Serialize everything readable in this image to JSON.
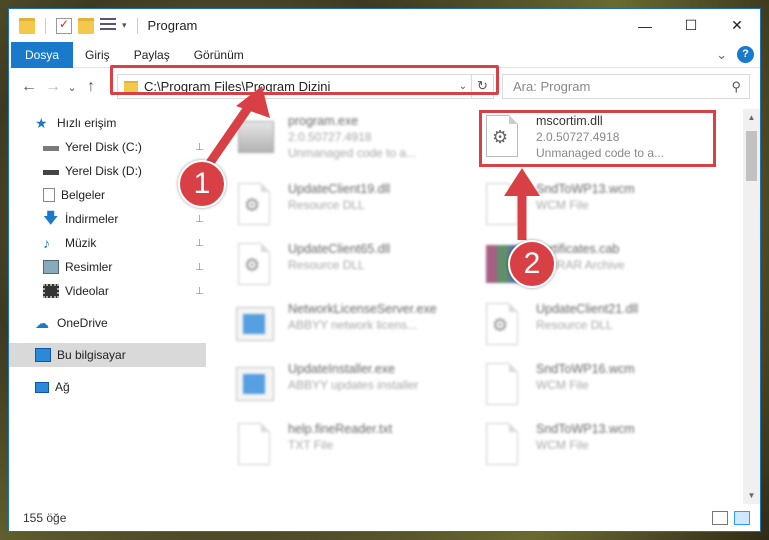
{
  "window": {
    "title": "Program",
    "controls": {
      "minimize": "—",
      "maximize": "☐",
      "close": "✕"
    }
  },
  "ribbon": {
    "tabs": [
      {
        "label": "Dosya",
        "active": true
      },
      {
        "label": "Giriş",
        "active": false
      },
      {
        "label": "Paylaş",
        "active": false
      },
      {
        "label": "Görünüm",
        "active": false
      }
    ],
    "help": "?",
    "expand": "⌄"
  },
  "nav": {
    "back": "←",
    "forward": "→",
    "recent": "⌄",
    "up": "↑",
    "address": "C:\\Program Files\\Program Dizini",
    "dropdown": "⌄",
    "refresh": "↻",
    "search_placeholder": "Ara: Program",
    "search_icon": "⚲"
  },
  "sidebar": {
    "items": [
      {
        "label": "Hızlı erişim",
        "icon": "star-icon",
        "pinned": false
      },
      {
        "label": "Yerel Disk (C:)",
        "icon": "drive-icon",
        "pinned": true
      },
      {
        "label": "Yerel Disk (D:)",
        "icon": "drive-icon",
        "pinned": true
      },
      {
        "label": "Belgeler",
        "icon": "documents-icon",
        "pinned": true
      },
      {
        "label": "İndirmeler",
        "icon": "download-icon",
        "pinned": true
      },
      {
        "label": "Müzik",
        "icon": "music-icon",
        "pinned": true
      },
      {
        "label": "Resimler",
        "icon": "pictures-icon",
        "pinned": true
      },
      {
        "label": "Videolar",
        "icon": "videos-icon",
        "pinned": true
      },
      {
        "label": "OneDrive",
        "icon": "cloud-icon",
        "pinned": false
      },
      {
        "label": "Bu bilgisayar",
        "icon": "computer-icon",
        "pinned": false,
        "selected": true
      },
      {
        "label": "Ağ",
        "icon": "network-icon",
        "pinned": false
      }
    ],
    "pin_glyph": "📌"
  },
  "files": [
    {
      "name": "program.exe",
      "sub1": "2.0.50727.4918",
      "sub2": "Unmanaged code to a...",
      "icon": "exe-icon"
    },
    {
      "name": "mscortim.dll",
      "sub1": "2.0.50727.4918",
      "sub2": "Unmanaged code to a...",
      "icon": "dll-icon",
      "highlighted": true
    },
    {
      "name": "UpdateClient19.dll",
      "sub1": "Resource DLL",
      "sub2": "",
      "icon": "dll-icon"
    },
    {
      "name": "SndToWP13.wcm",
      "sub1": "WCM File",
      "sub2": "",
      "icon": "file-icon"
    },
    {
      "name": "UpdateClient65.dll",
      "sub1": "Resource DLL",
      "sub2": "",
      "icon": "dll-icon"
    },
    {
      "name": "certificates.cab",
      "sub1": "WinRAR Archive",
      "sub2": "",
      "icon": "archive-icon"
    },
    {
      "name": "NetworkLicenseServer.exe",
      "sub1": "ABBYY network licens...",
      "sub2": "",
      "icon": "app-icon"
    },
    {
      "name": "UpdateClient21.dll",
      "sub1": "Resource DLL",
      "sub2": "",
      "icon": "dll-icon"
    },
    {
      "name": "UpdateInstaller.exe",
      "sub1": "ABBYY updates installer",
      "sub2": "",
      "icon": "app-icon"
    },
    {
      "name": "SndToWP16.wcm",
      "sub1": "WCM File",
      "sub2": "",
      "icon": "file-icon"
    },
    {
      "name": "help.fineReader.txt",
      "sub1": "TXT File",
      "sub2": "",
      "icon": "file-icon"
    },
    {
      "name": "SndToWP13.wcm",
      "sub1": "WCM File",
      "sub2": "",
      "icon": "file-icon"
    }
  ],
  "status": {
    "count": "155 öğe"
  },
  "annotations": {
    "step1": "1",
    "step2": "2",
    "color": "#d94045"
  }
}
